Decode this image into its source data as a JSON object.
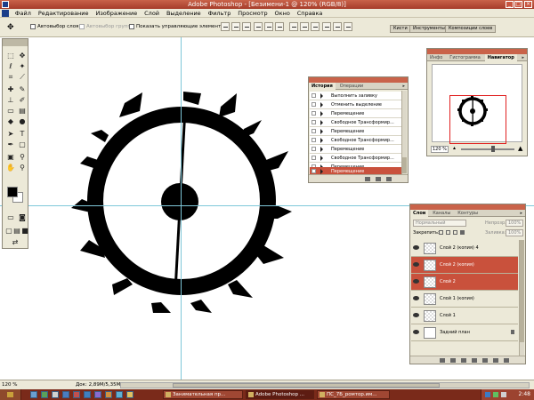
{
  "window": {
    "title": "Adobe Photoshop - [Безимени-1 @ 120% (RGB/8)]",
    "controls": [
      "_",
      "□",
      "×"
    ]
  },
  "menu": [
    "Файл",
    "Редактирование",
    "Изображение",
    "Слой",
    "Выделение",
    "Фильтр",
    "Просмотр",
    "Окно",
    "Справка"
  ],
  "options_bar": {
    "auto_select_layer": "Автовыбор слоя",
    "auto_select_groups": "Автовыбор групп",
    "show_transform_controls": "Показать управляющие элементы",
    "palette_tabs": [
      "Кисти",
      "Инструменты",
      "Композиции слоев"
    ]
  },
  "history": {
    "tabs": [
      "История",
      "Операции"
    ],
    "items": [
      {
        "label": "Выполнить заливку",
        "selected": false
      },
      {
        "label": "Отменить выделение",
        "selected": false
      },
      {
        "label": "Перемещение",
        "selected": false
      },
      {
        "label": "Свободное Трансформир...",
        "selected": false
      },
      {
        "label": "Перемещение",
        "selected": false
      },
      {
        "label": "Свободное Трансформир...",
        "selected": false
      },
      {
        "label": "Перемещение",
        "selected": false
      },
      {
        "label": "Свободное Трансформир...",
        "selected": false
      },
      {
        "label": "Перемещение",
        "selected": false
      },
      {
        "label": "Перемещение",
        "selected": true
      }
    ]
  },
  "navigator": {
    "tabs": [
      "Инфо",
      "Гистограмма",
      "Навигатор"
    ],
    "zoom": "120 %"
  },
  "layers": {
    "tabs": [
      "Слои",
      "Каналы",
      "Контуры"
    ],
    "blend_mode": "Нормальный",
    "opacity_label": "Непрозр.:",
    "opacity_value": "100%",
    "lock_label": "Закрепить:",
    "fill_label": "Заливка:",
    "fill_value": "100%",
    "items": [
      {
        "name": "Слой 2 (копия) 4",
        "selected": false,
        "type": "transparent"
      },
      {
        "name": "Слой 2 (копия)",
        "selected": true,
        "type": "transparent"
      },
      {
        "name": "Слой 2",
        "selected": true,
        "type": "transparent"
      },
      {
        "name": "Слой 1 (копия)",
        "selected": false,
        "type": "transparent"
      },
      {
        "name": "Слой 1",
        "selected": false,
        "type": "transparent"
      },
      {
        "name": "Задний план",
        "selected": false,
        "type": "white"
      }
    ]
  },
  "status": {
    "zoom": "120 %",
    "doc": "Док: 2,89M/5,35M"
  },
  "taskbar": {
    "buttons": [
      {
        "label": "Занимательная пр...",
        "active": false
      },
      {
        "label": "Adobe Photoshop ...",
        "active": true
      },
      {
        "label": "ПС_7Б_ромтор.им...",
        "active": false
      }
    ],
    "clock": "2:48"
  },
  "colors": {
    "accent": "#c9513c",
    "guide": "#7ec7d9",
    "panel": "#ece9d8"
  }
}
